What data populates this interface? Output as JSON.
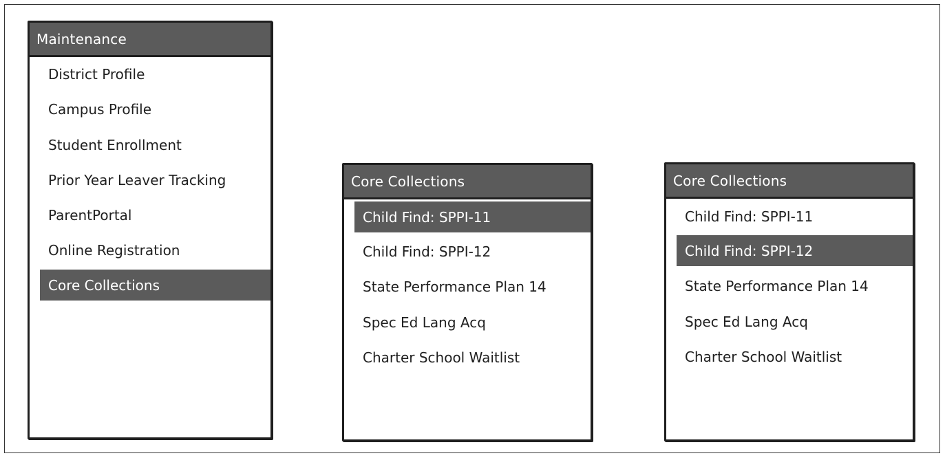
{
  "colors": {
    "header_bg": "#5b5b5b",
    "selected_bg": "#5b5b5b",
    "border": "#1f1f1f",
    "text": "#1f1f1f",
    "header_text": "#ffffff"
  },
  "panels": [
    {
      "title": "Maintenance",
      "items": [
        {
          "label": "District Profile",
          "selected": false
        },
        {
          "label": "Campus Profile",
          "selected": false
        },
        {
          "label": "Student Enrollment",
          "selected": false
        },
        {
          "label": "Prior Year Leaver Tracking",
          "selected": false
        },
        {
          "label": "ParentPortal",
          "selected": false
        },
        {
          "label": "Online Registration",
          "selected": false
        },
        {
          "label": "Core Collections",
          "selected": true
        }
      ]
    },
    {
      "title": "Core Collections",
      "items": [
        {
          "label": "Child Find:  SPPI-11",
          "selected": true
        },
        {
          "label": "Child Find:  SPPI-12",
          "selected": false
        },
        {
          "label": "State Performance Plan 14",
          "selected": false
        },
        {
          "label": "Spec Ed Lang Acq",
          "selected": false
        },
        {
          "label": "Charter School Waitlist",
          "selected": false
        }
      ]
    },
    {
      "title": "Core Collections",
      "items": [
        {
          "label": "Child Find:  SPPI-11",
          "selected": false
        },
        {
          "label": "Child Find:  SPPI-12",
          "selected": true
        },
        {
          "label": "State Performance Plan 14",
          "selected": false
        },
        {
          "label": "Spec Ed Lang Acq",
          "selected": false
        },
        {
          "label": "Charter School Waitlist",
          "selected": false
        }
      ]
    }
  ]
}
